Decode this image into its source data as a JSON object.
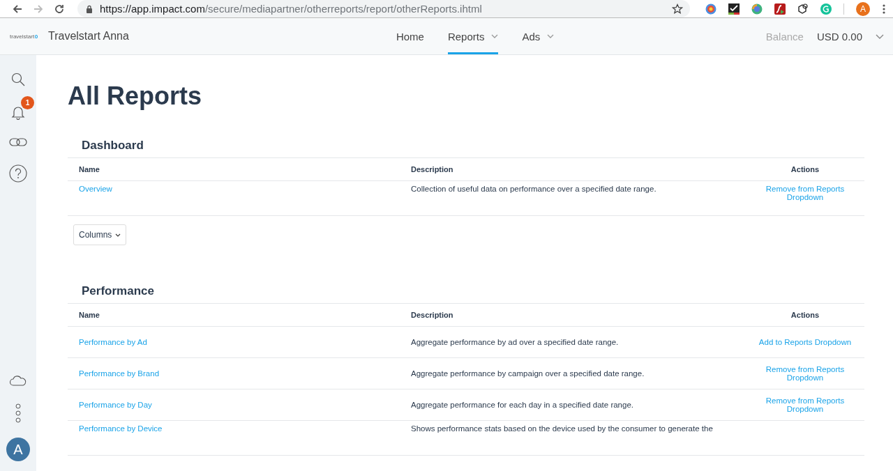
{
  "browser": {
    "url_host": "https://app.impact.com",
    "url_path": "/secure/mediapartner/otherreports/report/otherReports.ihtml",
    "profile": "A"
  },
  "header": {
    "logo": "travelstart",
    "account": "Travelstart Anna",
    "balance_label": "Balance",
    "balance_value": "USD 0.00"
  },
  "nav": [
    {
      "label": "Home",
      "selected": false,
      "dropdown": false
    },
    {
      "label": "Reports",
      "selected": true,
      "dropdown": true
    },
    {
      "label": "Ads",
      "selected": false,
      "dropdown": true
    }
  ],
  "sidebar": {
    "notifications": "1",
    "avatar": "A"
  },
  "page_title": "All Reports",
  "sections": [
    {
      "title": "Dashboard",
      "columns": [
        "Name",
        "Description",
        "Actions"
      ],
      "rows": [
        {
          "name": "Overview",
          "description": "Collection of useful data on performance over a specified date range.",
          "action": "Remove from Reports Dropdown"
        }
      ],
      "columns_button": "Columns"
    },
    {
      "title": "Performance",
      "columns": [
        "Name",
        "Description",
        "Actions"
      ],
      "rows": [
        {
          "name": "Performance by Ad",
          "description": "Aggregate performance by ad over a specified date range.",
          "action": "Add to Reports Dropdown"
        },
        {
          "name": "Performance by Brand",
          "description": "Aggregate performance by campaign over a specified date range.",
          "action": "Remove from Reports Dropdown"
        },
        {
          "name": "Performance by Day",
          "description": "Aggregate performance for each day in a specified date range.",
          "action": "Remove from Reports Dropdown"
        },
        {
          "name": "Performance by Device",
          "description": "Shows performance stats based on the device used by the consumer to generate the"
        }
      ]
    }
  ]
}
